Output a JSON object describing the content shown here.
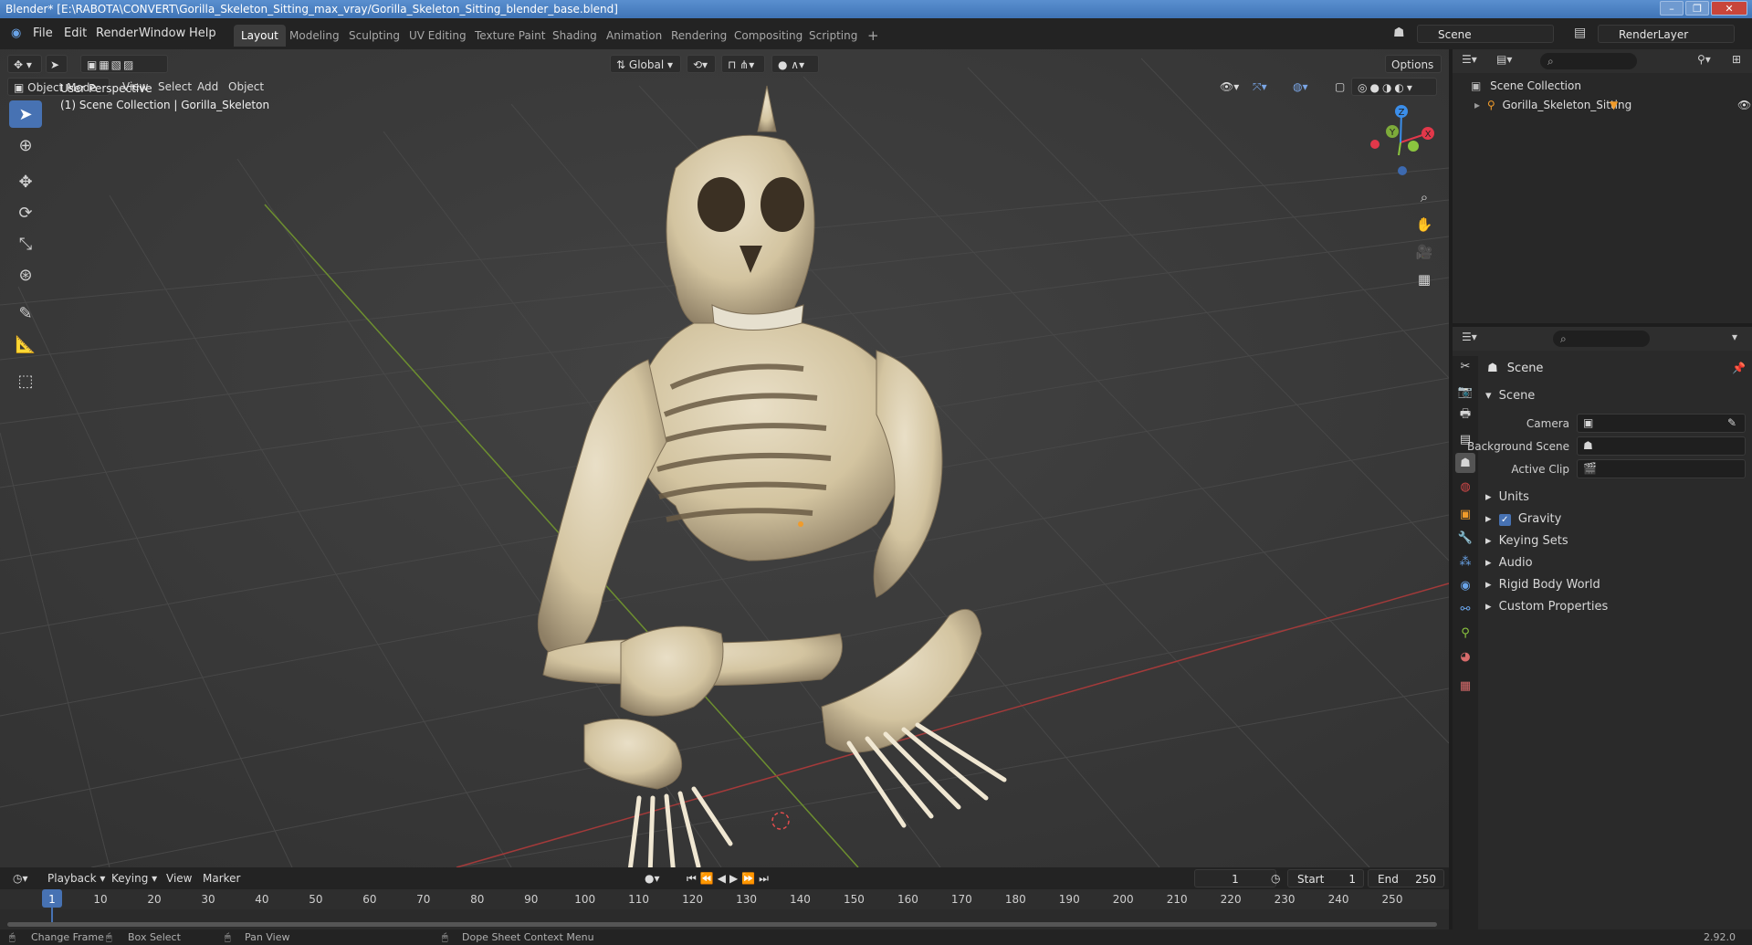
{
  "window": {
    "title": "Blender* [E:\\RABOTA\\CONVERT\\Gorilla_Skeleton_Sitting_max_vray/Gorilla_Skeleton_Sitting_blender_base.blend]",
    "minimize": "–",
    "maximize": "❐",
    "close": "✕"
  },
  "menu": {
    "file": "File",
    "edit": "Edit",
    "render": "Render",
    "window": "Window",
    "help": "Help"
  },
  "workspaces": [
    {
      "label": "Layout",
      "active": true
    },
    {
      "label": "Modeling"
    },
    {
      "label": "Sculpting"
    },
    {
      "label": "UV Editing"
    },
    {
      "label": "Texture Paint"
    },
    {
      "label": "Shading"
    },
    {
      "label": "Animation"
    },
    {
      "label": "Rendering"
    },
    {
      "label": "Compositing"
    },
    {
      "label": "Scripting"
    }
  ],
  "add_workspace": "+",
  "scene_field": "Scene",
  "view_layer_field": "RenderLayer",
  "viewport": {
    "mode": "Object Mode",
    "menus": {
      "view": "View",
      "select": "Select",
      "add": "Add",
      "object": "Object"
    },
    "transform_orientation": "Global",
    "options": "Options",
    "overlay_title": "User Perspective",
    "overlay_subtitle": "(1) Scene Collection | Gorilla_Skeleton",
    "gizmo": {
      "x": "X",
      "y": "Y",
      "z": "Z"
    }
  },
  "outliner": {
    "root": "Scene Collection",
    "items": [
      {
        "label": "Gorilla_Skeleton_Sitting"
      }
    ]
  },
  "properties": {
    "context": "Scene",
    "panel": "Scene",
    "camera_label": "Camera",
    "background_scene_label": "Background Scene",
    "active_clip_label": "Active Clip",
    "sections": [
      "Units",
      "Gravity",
      "Keying Sets",
      "Audio",
      "Rigid Body World",
      "Custom Properties"
    ],
    "gravity_enabled": true
  },
  "timeline": {
    "menus": {
      "playback": "Playback",
      "keying": "Keying",
      "view": "View",
      "marker": "Marker"
    },
    "current_frame": "1",
    "start_label": "Start",
    "start": "1",
    "end_label": "End",
    "end": "250",
    "ticks": [
      "1",
      "10",
      "20",
      "30",
      "40",
      "50",
      "60",
      "70",
      "80",
      "90",
      "100",
      "110",
      "120",
      "130",
      "140",
      "150",
      "160",
      "170",
      "180",
      "190",
      "200",
      "210",
      "220",
      "230",
      "240",
      "250"
    ]
  },
  "status": {
    "change_frame": "Change Frame",
    "box_select": "Box Select",
    "pan_view": "Pan View",
    "context_menu": "Dope Sheet Context Menu",
    "version": "2.92.0"
  },
  "colors": {
    "accent": "#4772b3",
    "x_axis": "#e2384a",
    "y_axis": "#8bc53f",
    "z_axis": "#3b8eea"
  }
}
